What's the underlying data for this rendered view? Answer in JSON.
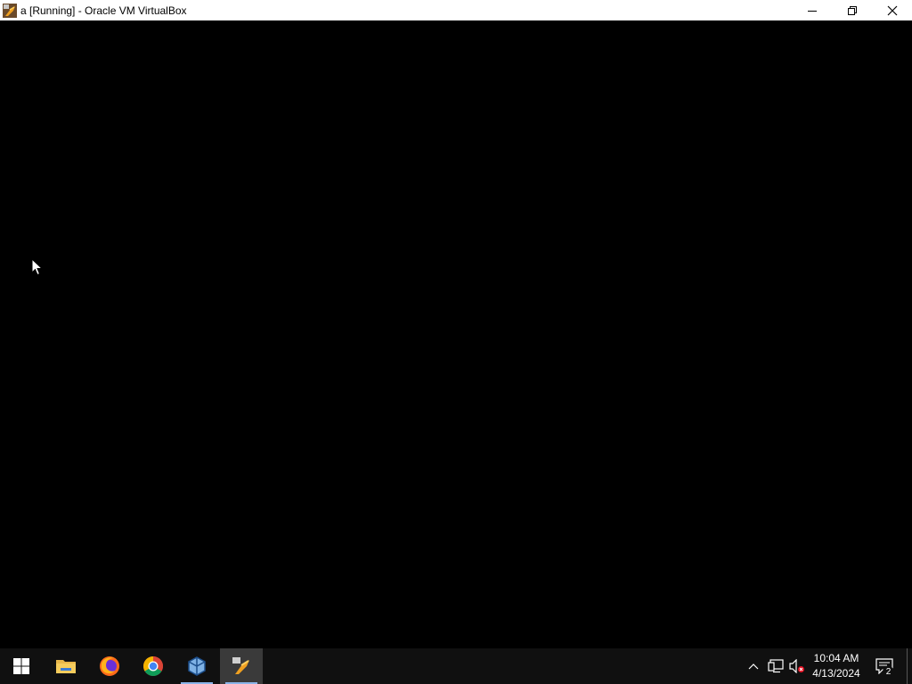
{
  "window": {
    "title": "a [Running] - Oracle VM VirtualBox",
    "controls": [
      "minimize",
      "restore",
      "close"
    ]
  },
  "taskbar": {
    "items": [
      {
        "name": "start",
        "icon": "windows-logo-icon"
      },
      {
        "name": "file-explorer",
        "icon": "folder-icon"
      },
      {
        "name": "firefox",
        "icon": "firefox-icon"
      },
      {
        "name": "chrome",
        "icon": "chrome-icon"
      },
      {
        "name": "virtualbox-manager",
        "icon": "virtualbox-icon"
      },
      {
        "name": "virtualbox-vm",
        "icon": "vm-running-icon",
        "active": true
      }
    ],
    "tray_icons": [
      "chevron-up-icon",
      "network-icon",
      "volume-muted-icon"
    ],
    "clock": {
      "time": "10:04 AM",
      "date": "4/13/2024"
    },
    "notifications": {
      "count": "2"
    }
  },
  "colors": {
    "titlebar": "#ffffff",
    "screen": "#000000",
    "taskbar": "#101010",
    "active_underline": "#8ab4e8"
  }
}
